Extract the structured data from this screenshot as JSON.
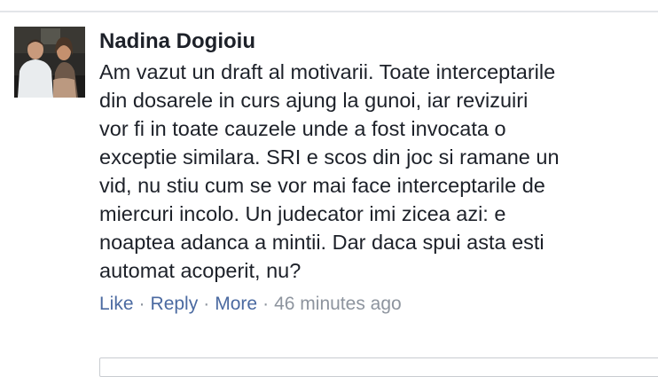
{
  "comment": {
    "author": "Nadina Dogioiu",
    "text_lines": [
      "Am vazut un draft al motivarii. Toate interceptarile",
      "din dosarele in curs ajung la gunoi, iar revizuiri",
      "vor fi in toate cauzele unde a fost invocata o",
      "exceptie similara. SRI e scos din joc si ramane un",
      "vid, nu stiu cum se vor mai face interceptarile de",
      "miercuri incolo. Un judecator imi zicea azi: e",
      "noaptea adanca a mintii. Dar daca spui asta esti",
      "automat acoperit, nu?"
    ],
    "actions": {
      "like": "Like",
      "reply": "Reply",
      "more": "More",
      "separator": "·",
      "timestamp": "46 minutes ago"
    }
  },
  "colors": {
    "link": "#4b6aa1",
    "meta": "#8d949e",
    "text": "#1d2129",
    "divider": "#e3e5e9"
  }
}
